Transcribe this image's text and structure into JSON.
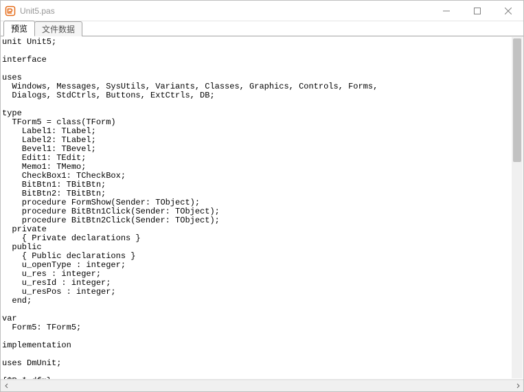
{
  "window": {
    "title": "Unit5.pas"
  },
  "tabs": {
    "items": [
      {
        "label": "预览"
      },
      {
        "label": "文件数据"
      }
    ],
    "activeIndex": 0
  },
  "code": "unit Unit5;\n\ninterface\n\nuses\n  Windows, Messages, SysUtils, Variants, Classes, Graphics, Controls, Forms,\n  Dialogs, StdCtrls, Buttons, ExtCtrls, DB;\n\ntype\n  TForm5 = class(TForm)\n    Label1: TLabel;\n    Label2: TLabel;\n    Bevel1: TBevel;\n    Edit1: TEdit;\n    Memo1: TMemo;\n    CheckBox1: TCheckBox;\n    BitBtn1: TBitBtn;\n    BitBtn2: TBitBtn;\n    procedure FormShow(Sender: TObject);\n    procedure BitBtn1Click(Sender: TObject);\n    procedure BitBtn2Click(Sender: TObject);\n  private\n    { Private declarations }\n  public\n    { Public declarations }\n    u_openType : integer;\n    u_res : integer;\n    u_resId : integer;\n    u_resPos : integer;\n  end;\n\nvar\n  Form5: TForm5;\n\nimplementation\n\nuses DmUnit;\n\n{$R *.dfm}"
}
